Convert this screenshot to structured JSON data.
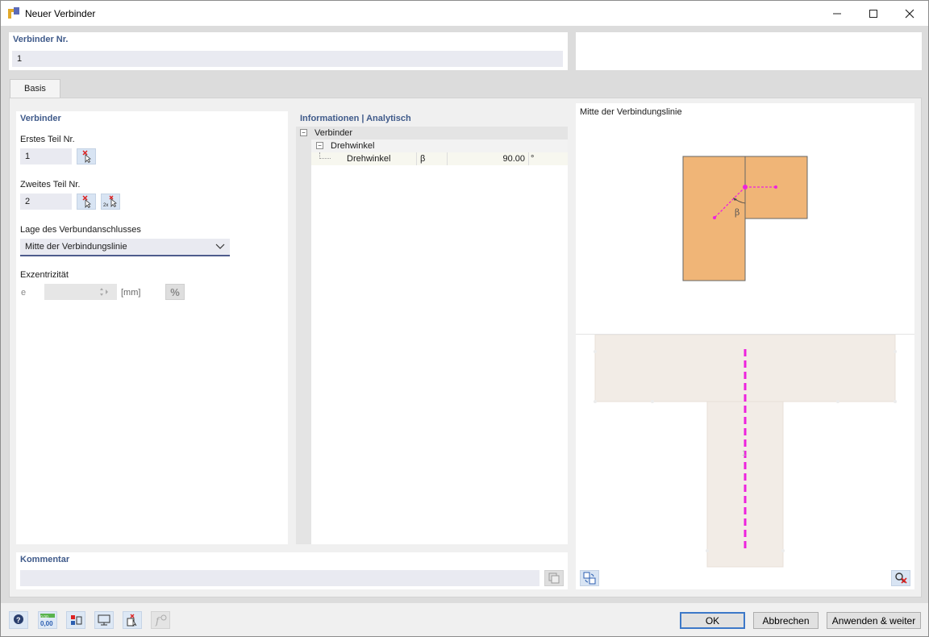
{
  "window": {
    "title": "Neuer Verbinder"
  },
  "header": {
    "number_label": "Verbinder Nr.",
    "number_value": "1"
  },
  "tabs": [
    {
      "label": "Basis",
      "active": true
    }
  ],
  "left": {
    "section_title": "Verbinder",
    "first_part_label": "Erstes Teil Nr.",
    "first_part_value": "1",
    "second_part_label": "Zweites Teil Nr.",
    "second_part_value": "2",
    "position_label": "Lage des Verbundanschlusses",
    "position_value": "Mitte der Verbindungslinie",
    "eccentricity_label": "Exzentrizität",
    "ecc_symbol": "e",
    "ecc_value": "",
    "ecc_unit": "[mm]",
    "percent_symbol": "%"
  },
  "info": {
    "title": "Informationen | Analytisch",
    "tree": [
      {
        "level": 0,
        "label": "Verbinder",
        "expander": "−"
      },
      {
        "level": 1,
        "label": "Drehwinkel",
        "expander": "−"
      },
      {
        "level": 2,
        "label": "Drehwinkel",
        "symbol": "β",
        "value": "90.00",
        "unit": "°"
      }
    ]
  },
  "preview": {
    "title": "Mitte der Verbindungslinie",
    "beta_label": "β",
    "node_label": "1"
  },
  "comment": {
    "label": "Kommentar",
    "value": ""
  },
  "buttons": {
    "ok": "OK",
    "cancel": "Abbrechen",
    "apply": "Anwenden & weiter"
  },
  "toolbar": {
    "units_top": "0,00",
    "units_bottom": "0,00"
  },
  "colors": {
    "accent": "#3f5a8a",
    "member_fill": "#f0b577",
    "connector_line": "#ee22dd",
    "member_3d": "#f2ece6"
  }
}
